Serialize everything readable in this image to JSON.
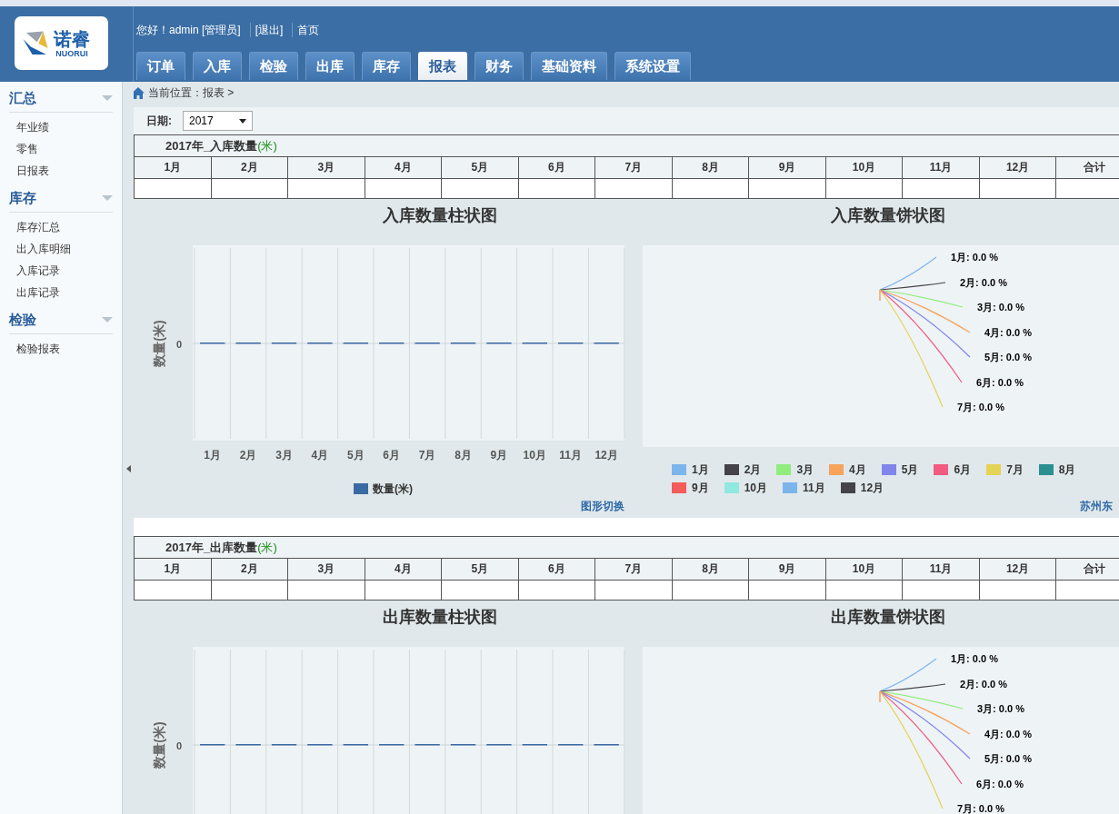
{
  "header": {
    "logo_name": "诺睿",
    "logo_sub": "NUORUI",
    "greeting": "您好！admin [管理员]",
    "links": [
      "[退出]",
      "首页"
    ],
    "tabs": [
      {
        "label": "订单",
        "selected": false
      },
      {
        "label": "入库",
        "selected": false
      },
      {
        "label": "检验",
        "selected": false
      },
      {
        "label": "出库",
        "selected": false
      },
      {
        "label": "库存",
        "selected": false
      },
      {
        "label": "报表",
        "selected": true
      },
      {
        "label": "财务",
        "selected": false
      },
      {
        "label": "基础资料",
        "selected": false
      },
      {
        "label": "系统设置",
        "selected": false
      }
    ]
  },
  "sidebar": {
    "groups": [
      {
        "title": "汇总",
        "items": [
          "年业绩",
          "零售",
          "日报表"
        ]
      },
      {
        "title": "库存",
        "items": [
          "库存汇总",
          "出入库明细",
          "入库记录",
          "出库记录"
        ]
      },
      {
        "title": "检验",
        "items": [
          "检验报表"
        ]
      }
    ]
  },
  "breadcrumb": "当前位置：报表 >",
  "filter": {
    "label": "日期:",
    "value": "2017"
  },
  "sections": [
    {
      "table": {
        "title": "2017年_入库数量",
        "unit": "(米)",
        "columns": [
          "1月",
          "2月",
          "3月",
          "4月",
          "5月",
          "6月",
          "7月",
          "8月",
          "9月",
          "10月",
          "11月",
          "12月",
          "合计"
        ]
      },
      "bar": {
        "title": "入库数量柱状图",
        "y_axis_label": "数量(米)",
        "y_tick": "0",
        "categories": [
          "1月",
          "2月",
          "3月",
          "4月",
          "5月",
          "6月",
          "7月",
          "8月",
          "9月",
          "10月",
          "11月",
          "12月"
        ],
        "legend": {
          "label": "数量(米)",
          "color": "#3a6aa3"
        },
        "link": "图形切换"
      },
      "pie": {
        "title": "入库数量饼状图",
        "data_labels": [
          {
            "text": "1月: 0.0 %",
            "color": "#7cb5ec"
          },
          {
            "text": "2月: 0.0 %",
            "color": "#434348"
          },
          {
            "text": "3月: 0.0 %",
            "color": "#90ed7d"
          },
          {
            "text": "4月: 0.0 %",
            "color": "#f7a35c"
          },
          {
            "text": "5月: 0.0 %",
            "color": "#8085e9"
          },
          {
            "text": "6月: 0.0 %",
            "color": "#f15c80"
          },
          {
            "text": "7月: 0.0 %",
            "color": "#e4d354"
          }
        ],
        "legend": [
          {
            "label": "1月",
            "color": "#7cb5ec"
          },
          {
            "label": "2月",
            "color": "#434348"
          },
          {
            "label": "3月",
            "color": "#90ed7d"
          },
          {
            "label": "4月",
            "color": "#f7a35c"
          },
          {
            "label": "5月",
            "color": "#8085e9"
          },
          {
            "label": "6月",
            "color": "#f15c80"
          },
          {
            "label": "7月",
            "color": "#e4d354"
          },
          {
            "label": "8月",
            "color": "#2b908f"
          },
          {
            "label": "9月",
            "color": "#f45b5b"
          },
          {
            "label": "10月",
            "color": "#91e8e1"
          },
          {
            "label": "11月",
            "color": "#7cb5ec"
          },
          {
            "label": "12月",
            "color": "#434348"
          }
        ],
        "link": "苏州东"
      }
    },
    {
      "table": {
        "title": "2017年_出库数量",
        "unit": "(米)",
        "columns": [
          "1月",
          "2月",
          "3月",
          "4月",
          "5月",
          "6月",
          "7月",
          "8月",
          "9月",
          "10月",
          "11月",
          "12月",
          "合计"
        ]
      },
      "bar": {
        "title": "出库数量柱状图",
        "y_axis_label": "数量(米)",
        "y_tick": "0"
      },
      "pie": {
        "title": "出库数量饼状图",
        "data_labels": [
          {
            "text": "1月: 0.0 %",
            "color": "#7cb5ec"
          },
          {
            "text": "2月: 0.0 %",
            "color": "#434348"
          },
          {
            "text": "3月: 0.0 %",
            "color": "#90ed7d"
          },
          {
            "text": "4月: 0.0 %",
            "color": "#f7a35c"
          },
          {
            "text": "5月: 0.0 %",
            "color": "#8085e9"
          },
          {
            "text": "6月: 0.0 %",
            "color": "#f15c80"
          },
          {
            "text": "7月: 0.0 %",
            "color": "#e4d354"
          }
        ]
      }
    }
  ]
}
